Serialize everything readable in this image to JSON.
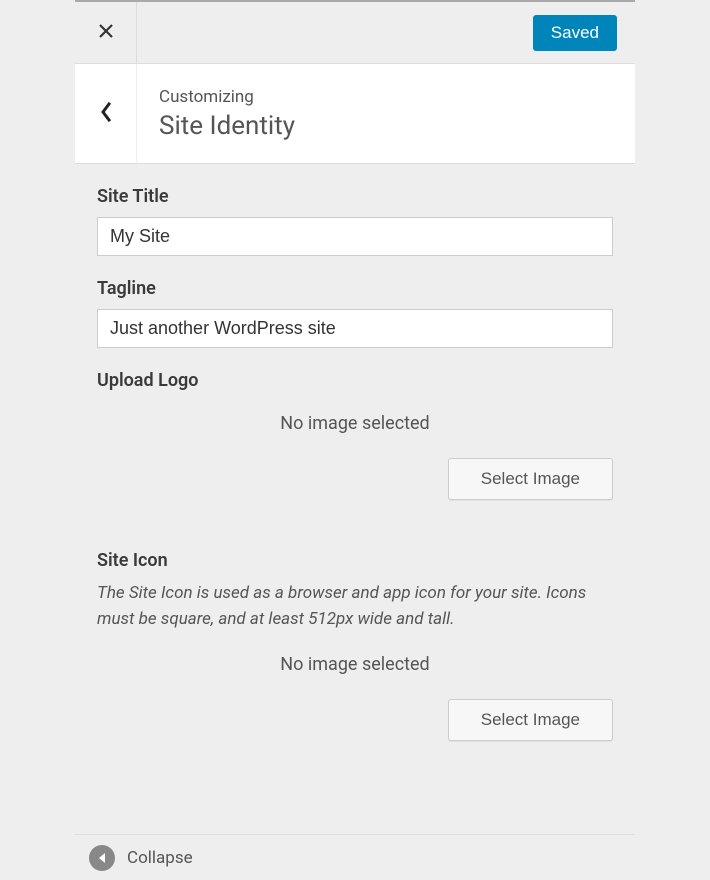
{
  "topbar": {
    "saved_label": "Saved"
  },
  "header": {
    "breadcrumb": "Customizing",
    "panel_title": "Site Identity"
  },
  "fields": {
    "site_title": {
      "label": "Site Title",
      "value": "My Site"
    },
    "tagline": {
      "label": "Tagline",
      "value": "Just another WordPress site"
    },
    "upload_logo": {
      "label": "Upload Logo",
      "no_image_text": "No image selected",
      "button_label": "Select Image"
    },
    "site_icon": {
      "label": "Site Icon",
      "description": "The Site Icon is used as a browser and app icon for your site. Icons must be square, and at least 512px wide and tall.",
      "no_image_text": "No image selected",
      "button_label": "Select Image"
    }
  },
  "footer": {
    "collapse_label": "Collapse"
  }
}
